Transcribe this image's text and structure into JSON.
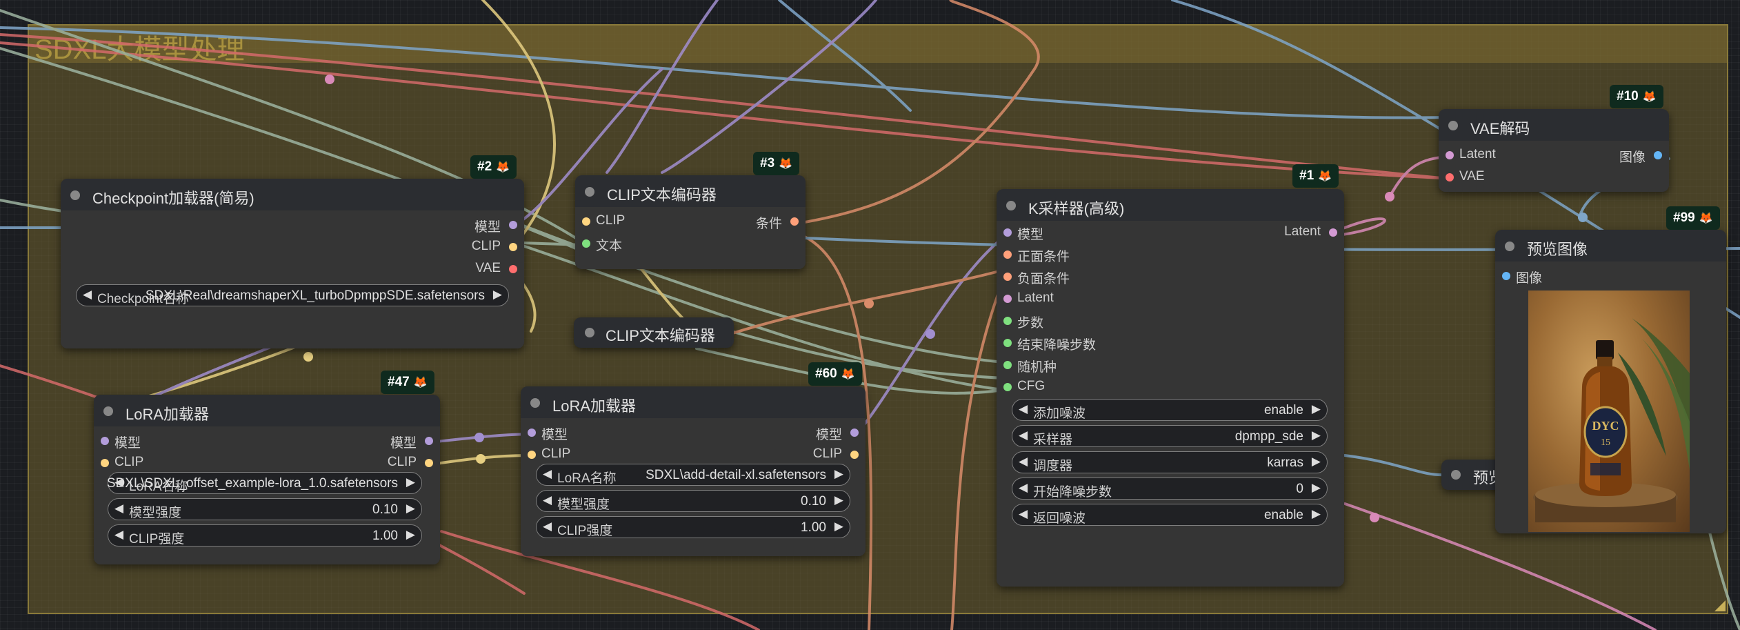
{
  "group": {
    "title": "SDXL大模型处理"
  },
  "nodes": {
    "checkpoint": {
      "badge": "#2",
      "title": "Checkpoint加载器(简易)",
      "outputs": [
        "模型",
        "CLIP",
        "VAE"
      ],
      "widget": {
        "label": "Checkpoint名称",
        "value": "SDXL\\Real\\dreamshaperXL_turboDpmppSDE.safetensors"
      }
    },
    "clip_encoder_1": {
      "badge": "#3",
      "title": "CLIP文本编码器",
      "inputs": [
        "CLIP",
        "文本"
      ],
      "outputs": [
        "条件"
      ]
    },
    "clip_encoder_2": {
      "title": "CLIP文本编码器"
    },
    "ksampler": {
      "badge": "#1",
      "title": "K采样器(高级)",
      "inputs": [
        "模型",
        "正面条件",
        "负面条件",
        "Latent",
        "步数",
        "结束降噪步数",
        "随机种",
        "CFG"
      ],
      "outputs": [
        "Latent"
      ],
      "widgets": [
        {
          "label": "添加噪波",
          "value": "enable"
        },
        {
          "label": "采样器",
          "value": "dpmpp_sde"
        },
        {
          "label": "调度器",
          "value": "karras"
        },
        {
          "label": "开始降噪步数",
          "value": "0"
        },
        {
          "label": "返回噪波",
          "value": "enable"
        }
      ]
    },
    "vae_decode": {
      "badge": "#10",
      "title": "VAE解码",
      "inputs": [
        "Latent",
        "VAE"
      ],
      "outputs": [
        "图像"
      ]
    },
    "preview": {
      "badge": "#99",
      "title": "预览图像",
      "inputs": [
        "图像"
      ]
    },
    "preview_collapsed": {
      "title": "预览"
    },
    "lora_1": {
      "badge": "#47",
      "title": "LoRA加载器",
      "inputs": [
        "模型",
        "CLIP"
      ],
      "outputs": [
        "模型",
        "CLIP"
      ],
      "widgets": [
        {
          "label": "LoRA名称",
          "value": "SDXL\\SDXL_offset_example-lora_1.0.safetensors"
        },
        {
          "label": "模型强度",
          "value": "0.10"
        },
        {
          "label": "CLIP强度",
          "value": "1.00"
        }
      ]
    },
    "lora_2": {
      "badge": "#60",
      "title": "LoRA加载器",
      "inputs": [
        "模型",
        "CLIP"
      ],
      "outputs": [
        "模型",
        "CLIP"
      ],
      "widgets": [
        {
          "label": "LoRA名称",
          "value": "SDXL\\add-detail-xl.safetensors"
        },
        {
          "label": "模型强度",
          "value": "0.10"
        },
        {
          "label": "CLIP强度",
          "value": "1.00"
        }
      ]
    }
  },
  "icons": {
    "badge_icon": "fox-icon",
    "arrow_left": "◀",
    "arrow_right": "▶"
  },
  "colors": {
    "model": "#b39ddb",
    "clip": "#ffd580",
    "vae": "#ff6e6e",
    "conditioning": "#ffa07a",
    "latent": "#ff9cf9",
    "int": "#7fe07f",
    "image": "#64b5f6",
    "group": "#a8913e"
  }
}
